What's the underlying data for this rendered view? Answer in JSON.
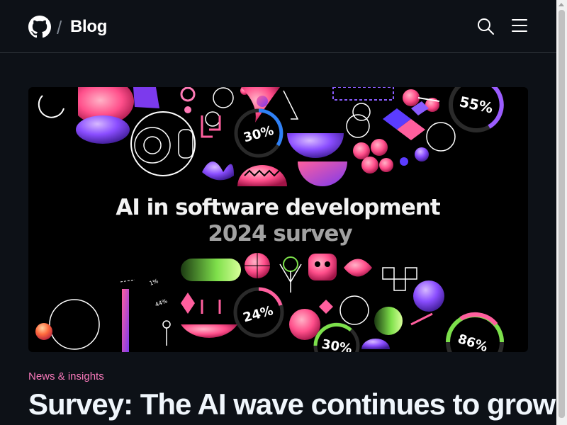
{
  "header": {
    "logo_icon": "github-mark-icon",
    "separator": "/",
    "blog_label": "Blog",
    "search_icon": "search-icon",
    "menu_icon": "hamburger-menu-icon"
  },
  "hero": {
    "title": "AI in software development",
    "subtitle": "2024 survey",
    "percent_labels": [
      "55%",
      "30%",
      "24%",
      "30%",
      "86%"
    ],
    "small_labels": [
      "1%",
      "44%"
    ]
  },
  "article": {
    "category": "News & insights",
    "title": "Survey: The AI wave continues to grow"
  },
  "colors": {
    "background": "#0d1117",
    "category": "#f778ba",
    "border": "#30363d"
  }
}
